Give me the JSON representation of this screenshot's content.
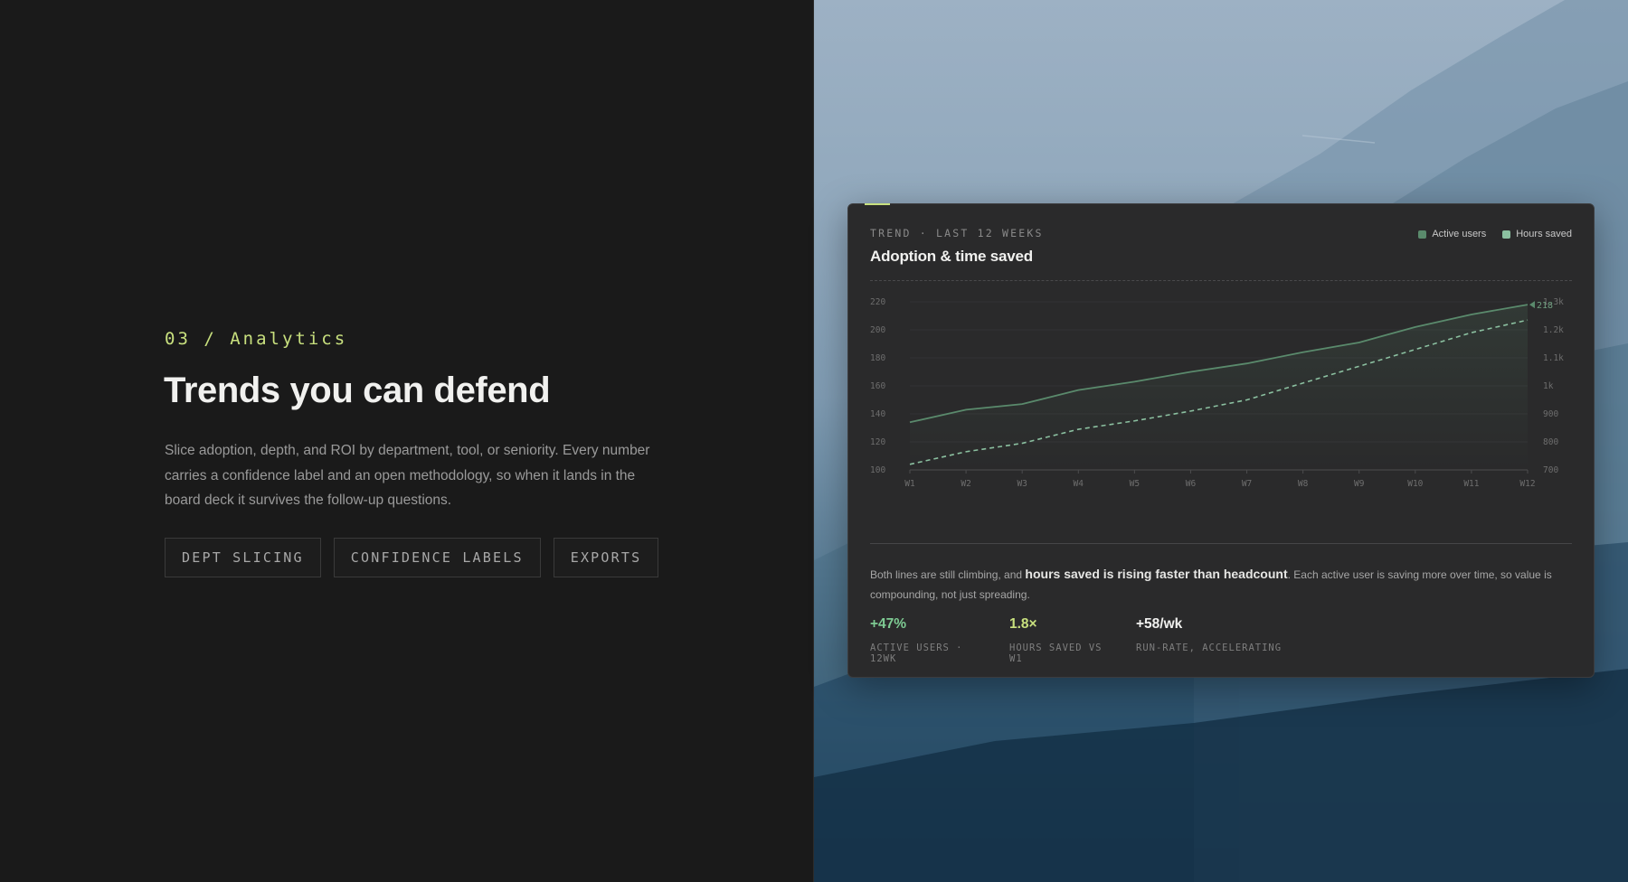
{
  "section": {
    "eyebrow": "03 / Analytics",
    "title": "Trends you can defend",
    "description": "Slice adoption, depth, and ROI by department, tool, or seniority. Every number carries a confidence label and an open methodology, so when it lands in the board deck it survives the follow-up questions.",
    "chips": [
      "DEPT SLICING",
      "CONFIDENCE LABELS",
      "EXPORTS"
    ]
  },
  "card": {
    "eyebrow": "TREND · LAST 12 WEEKS",
    "title": "Adoption & time saved",
    "legend": [
      {
        "label": "Active users",
        "color": "#5a8a6c"
      },
      {
        "label": "Hours saved",
        "color": "#8bc0a0"
      }
    ],
    "summary_pre": "Both lines are still climbing, and ",
    "summary_bold": "hours saved is rising faster than headcount",
    "summary_post": ". Each active user is saving more over time, so value is compounding, not just spreading.",
    "stats": [
      {
        "value": "+47%",
        "label": "ACTIVE USERS · 12WK",
        "color": "#7ecb93"
      },
      {
        "value": "1.8×",
        "label": "HOURS SAVED VS W1",
        "color": "#c8e07e"
      },
      {
        "value": "+58/wk",
        "label": "RUN-RATE, ACCELERATING",
        "color": "#f1f1ef"
      }
    ]
  },
  "chart_data": {
    "type": "line",
    "x": [
      "W1",
      "W2",
      "W3",
      "W4",
      "W5",
      "W6",
      "W7",
      "W8",
      "W9",
      "W10",
      "W11",
      "W12"
    ],
    "y_left_ticks": [
      "100",
      "120",
      "140",
      "160",
      "180",
      "200",
      "220"
    ],
    "y_left_range": [
      100,
      220
    ],
    "y_right_ticks": [
      "700",
      "800",
      "900",
      "1k",
      "1.1k",
      "1.2k",
      "1.3k"
    ],
    "y_right_range": [
      700,
      1300
    ],
    "series": [
      {
        "name": "Active users",
        "axis": "left",
        "style": "solid",
        "color": "#5a8a6c",
        "values": [
          134,
          143,
          147,
          157,
          163,
          170,
          176,
          184,
          191,
          202,
          211,
          218
        ]
      },
      {
        "name": "Hours saved",
        "axis": "right",
        "style": "dashed",
        "color": "#8bc0a0",
        "values": [
          720,
          765,
          795,
          845,
          875,
          910,
          950,
          1010,
          1070,
          1130,
          1190,
          1235
        ]
      }
    ],
    "end_label": "218"
  },
  "colors": {
    "accent": "#c8e07e",
    "positive": "#7ecb93"
  }
}
